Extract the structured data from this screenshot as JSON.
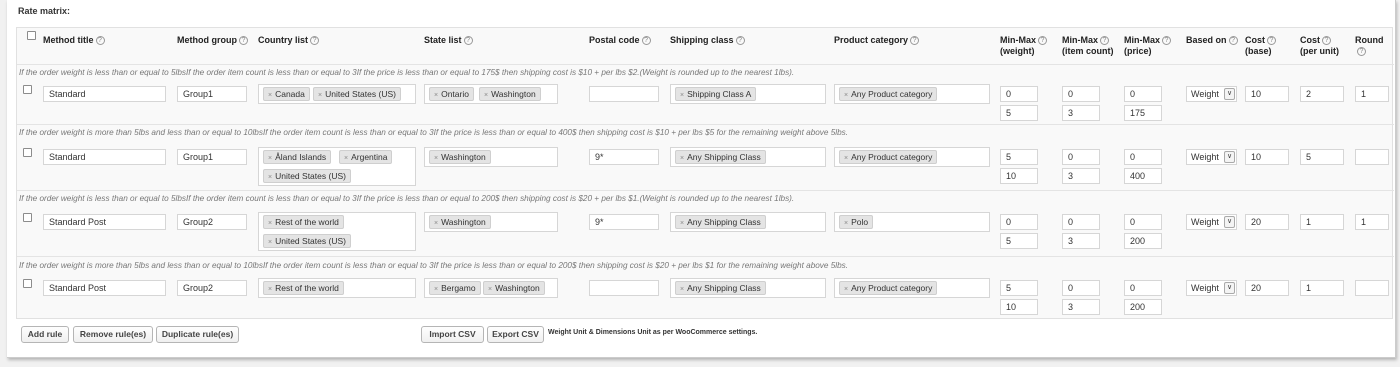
{
  "title": "Rate matrix:",
  "headers": {
    "method_title": "Method title",
    "method_group": "Method group",
    "country_list": "Country list",
    "state_list": "State list",
    "postal_code": "Postal code",
    "shipping_class": "Shipping class",
    "product_category": "Product category",
    "minmax_weight_1": "Min-Max",
    "minmax_weight_2": "(weight)",
    "minmax_count_1": "Min-Max",
    "minmax_count_2": "(item count)",
    "minmax_price_1": "Min-Max",
    "minmax_price_2": "(price)",
    "based_on": "Based on",
    "cost_base_1": "Cost",
    "cost_base_2": "(base)",
    "cost_unit_1": "Cost",
    "cost_unit_2": "(per unit)",
    "round": "Round"
  },
  "help_glyph": "?",
  "tag_remove_glyph": "×",
  "select_arrow": "∨",
  "rows": [
    {
      "note": "If the order weight is less than or equal to 5lbsIf the order item count is less than or equal to 3If the price is less than or equal to 175$ then shipping cost is $10 + per lbs $2.(Weight is rounded up to the nearest 1lbs).",
      "method_title": "Standard",
      "method_group": "Group1",
      "countries": [
        "Canada",
        "United States (US)"
      ],
      "states": [
        "Ontario",
        "Washington"
      ],
      "postal_code": "",
      "shipping_class": "Shipping Class A",
      "category": "Any Product category",
      "weight_min": "0",
      "weight_max": "5",
      "count_min": "0",
      "count_max": "3",
      "price_min": "0",
      "price_max": "175",
      "based_on": "Weight",
      "cost_base": "10",
      "cost_unit": "2",
      "round": "1"
    },
    {
      "note": "If the order weight is more than 5lbs and less than or equal to 10lbsIf the order item count is less than or equal to 3If the price is less than or equal to 400$ then shipping cost is $10 + per lbs $5 for the remaining weight above 5lbs.",
      "method_title": "Standard",
      "method_group": "Group1",
      "countries": [
        "Åland Islands",
        "Argentina",
        "United States (US)"
      ],
      "states": [
        "Washington"
      ],
      "postal_code": "9*",
      "shipping_class": "Any Shipping Class",
      "category": "Any Product category",
      "weight_min": "5",
      "weight_max": "10",
      "count_min": "0",
      "count_max": "3",
      "price_min": "0",
      "price_max": "400",
      "based_on": "Weight",
      "cost_base": "10",
      "cost_unit": "5",
      "round": ""
    },
    {
      "note": "If the order weight is less than or equal to 5lbsIf the order item count is less than or equal to 3If the price is less than or equal to 200$ then shipping cost is $20 + per lbs $1.(Weight is rounded up to the nearest 1lbs).",
      "method_title": "Standard Post",
      "method_group": "Group2",
      "countries": [
        "Rest of the world",
        "United States (US)"
      ],
      "states": [
        "Washington"
      ],
      "postal_code": "9*",
      "shipping_class": "Any Shipping Class",
      "category": "Polo",
      "weight_min": "0",
      "weight_max": "5",
      "count_min": "0",
      "count_max": "3",
      "price_min": "0",
      "price_max": "200",
      "based_on": "Weight",
      "cost_base": "20",
      "cost_unit": "1",
      "round": "1"
    },
    {
      "note": "If the order weight is more than 5lbs and less than or equal to 10lbsIf the order item count is less than or equal to 3If the price is less than or equal to 200$ then shipping cost is $20 + per lbs $1 for the remaining weight above 5lbs.",
      "method_title": "Standard Post",
      "method_group": "Group2",
      "countries": [
        "Rest of the world"
      ],
      "states": [
        "Bergamo",
        "Washington"
      ],
      "postal_code": "",
      "shipping_class": "Any Shipping Class",
      "category": "Any Product category",
      "weight_min": "5",
      "weight_max": "10",
      "count_min": "0",
      "count_max": "3",
      "price_min": "0",
      "price_max": "200",
      "based_on": "Weight",
      "cost_base": "20",
      "cost_unit": "1",
      "round": ""
    }
  ],
  "buttons": {
    "add_rule": "Add rule",
    "remove_rules": "Remove rule(es)",
    "duplicate_rules": "Duplicate rule(es)",
    "import_csv": "Import CSV",
    "export_csv": "Export CSV"
  },
  "footnote": "Weight Unit & Dimensions Unit as per WooCommerce settings."
}
